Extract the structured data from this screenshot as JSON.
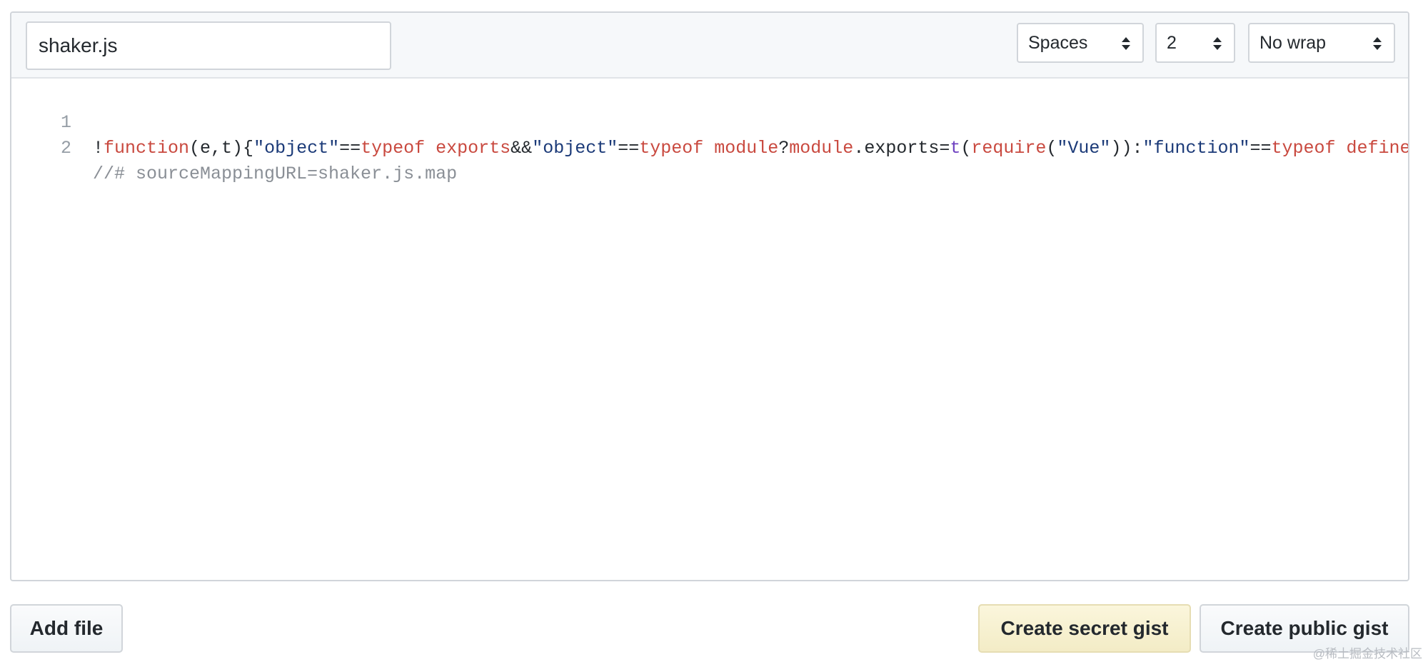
{
  "file": {
    "filename": "shaker.js"
  },
  "editor_options": {
    "indent_mode": "Spaces",
    "indent_size": "2",
    "wrap_mode": "No wrap"
  },
  "code": {
    "line1_number": "1",
    "line2_number": "2",
    "tokens": {
      "t01": "!",
      "t02": "function",
      "t03": "(e,t){",
      "t04": "\"object\"",
      "t05": "==",
      "t06": "typeof",
      "t07": " ",
      "t08": "exports",
      "t09": "&&",
      "t10": "\"object\"",
      "t11": "==",
      "t12": "typeof",
      "t13": " ",
      "t14": "module",
      "t15": "?",
      "t16": "module",
      "t17": ".exports=",
      "t18": "t",
      "t19": "(",
      "t20": "require",
      "t21": "(",
      "t22": "\"Vue\"",
      "t23": ")):",
      "t24": "\"function\"",
      "t25": "==",
      "t26": "typeof",
      "t27": " ",
      "t28": "define",
      "t29": "&&",
      "t30": "def"
    },
    "line2": "//# sourceMappingURL=shaker.js.map"
  },
  "actions": {
    "add_file": "Add file",
    "create_secret": "Create secret gist",
    "create_public": "Create public gist"
  },
  "watermark": "@稀土掘金技术社区",
  "colors": {
    "keyword": "#c9493f",
    "string": "#1b3a78",
    "function_call": "#6f42c1",
    "comment": "#8a8f96",
    "secret_button_bg": "#fbf6dc"
  },
  "icons": {
    "select_caret": "up-down-caret-icon"
  }
}
